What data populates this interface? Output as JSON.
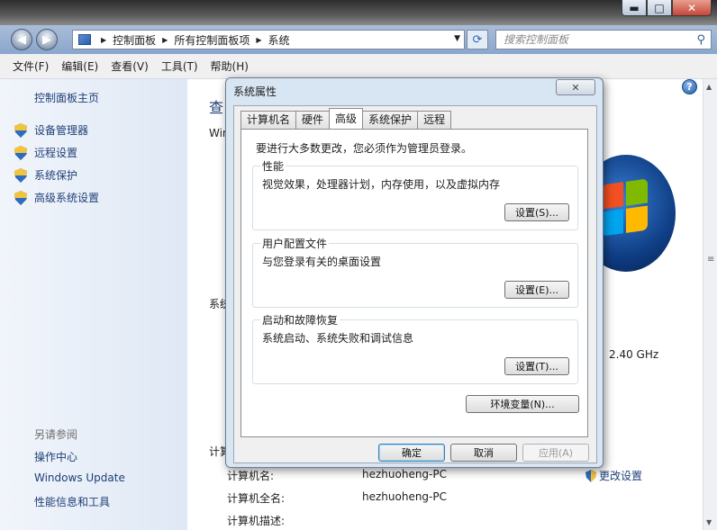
{
  "window": {
    "minimize_glyph": "▬",
    "maximize_glyph": "□",
    "close_glyph": "✕"
  },
  "address": {
    "path": [
      "控制面板",
      "所有控制面板项",
      "系统"
    ],
    "search_placeholder": "搜索控制面板"
  },
  "menu": [
    "文件(F)",
    "编辑(E)",
    "查看(V)",
    "工具(T)",
    "帮助(H)"
  ],
  "sidebar": {
    "home": "控制面板主页",
    "items": [
      "设备管理器",
      "远程设置",
      "系统保护",
      "高级系统设置"
    ],
    "see_also_title": "另请参阅",
    "see_also": [
      "操作中心",
      "Windows Update",
      "性能信息和工具"
    ]
  },
  "background": {
    "heading_fragment": "查",
    "win_fragment": "Win",
    "system_fragment": "系统",
    "computer_fragment": "计算",
    "cpu_speed": "2.40 GHz",
    "rows": [
      {
        "label": "计算机名:",
        "value": "hezhuoheng-PC"
      },
      {
        "label": "计算机全名:",
        "value": "hezhuoheng-PC"
      },
      {
        "label": "计算机描述:",
        "value": ""
      }
    ],
    "change_settings": "更改设置"
  },
  "dialog": {
    "title": "系统属性",
    "tabs": [
      "计算机名",
      "硬件",
      "高级",
      "系统保护",
      "远程"
    ],
    "active_tab": "高级",
    "intro": "要进行大多数更改，您必须作为管理员登录。",
    "groups": [
      {
        "title": "性能",
        "desc": "视觉效果，处理器计划，内存使用，以及虚拟内存",
        "button": "设置(S)..."
      },
      {
        "title": "用户配置文件",
        "desc": "与您登录有关的桌面设置",
        "button": "设置(E)..."
      },
      {
        "title": "启动和故障恢复",
        "desc": "系统启动、系统失败和调试信息",
        "button": "设置(T)..."
      }
    ],
    "env_button": "环境变量(N)...",
    "ok": "确定",
    "cancel": "取消",
    "apply": "应用(A)"
  }
}
